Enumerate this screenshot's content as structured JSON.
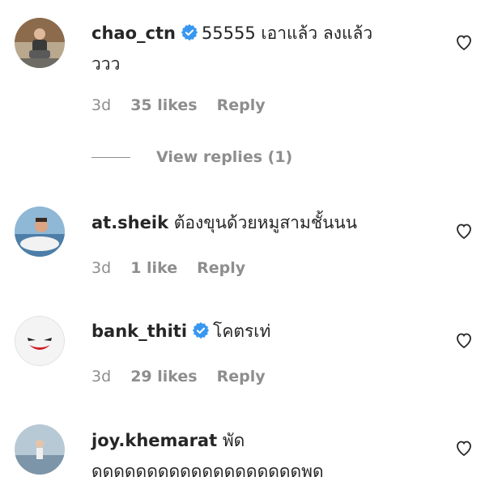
{
  "comments": [
    {
      "username": "chao_ctn",
      "verified": true,
      "text_line1": "55555 เอาแล้ว ลงแล้ว",
      "text_line2": "ววว",
      "time": "3d",
      "likes": "35 likes",
      "reply": "Reply"
    },
    {
      "username": "at.sheik",
      "verified": false,
      "text_line1": "ต้องขุนด้วยหมูสามชั้นนน",
      "time": "3d",
      "likes": "1 like",
      "reply": "Reply"
    },
    {
      "username": "bank_thiti",
      "verified": true,
      "text_line1": "โคตรเท่",
      "time": "3d",
      "likes": "29 likes",
      "reply": "Reply"
    },
    {
      "username": "joy.khemarat",
      "verified": false,
      "text_line1": "พัด",
      "text_line2": "ดดดดดดดดดดดดดดดดดดดพด"
    }
  ],
  "view_replies": "View replies (1)",
  "colors": {
    "verified": "#3897f0",
    "meta": "#8e8e8e",
    "text": "#262626"
  },
  "icons": {
    "like": "heart-outline-icon",
    "verified": "verified-badge-icon"
  }
}
